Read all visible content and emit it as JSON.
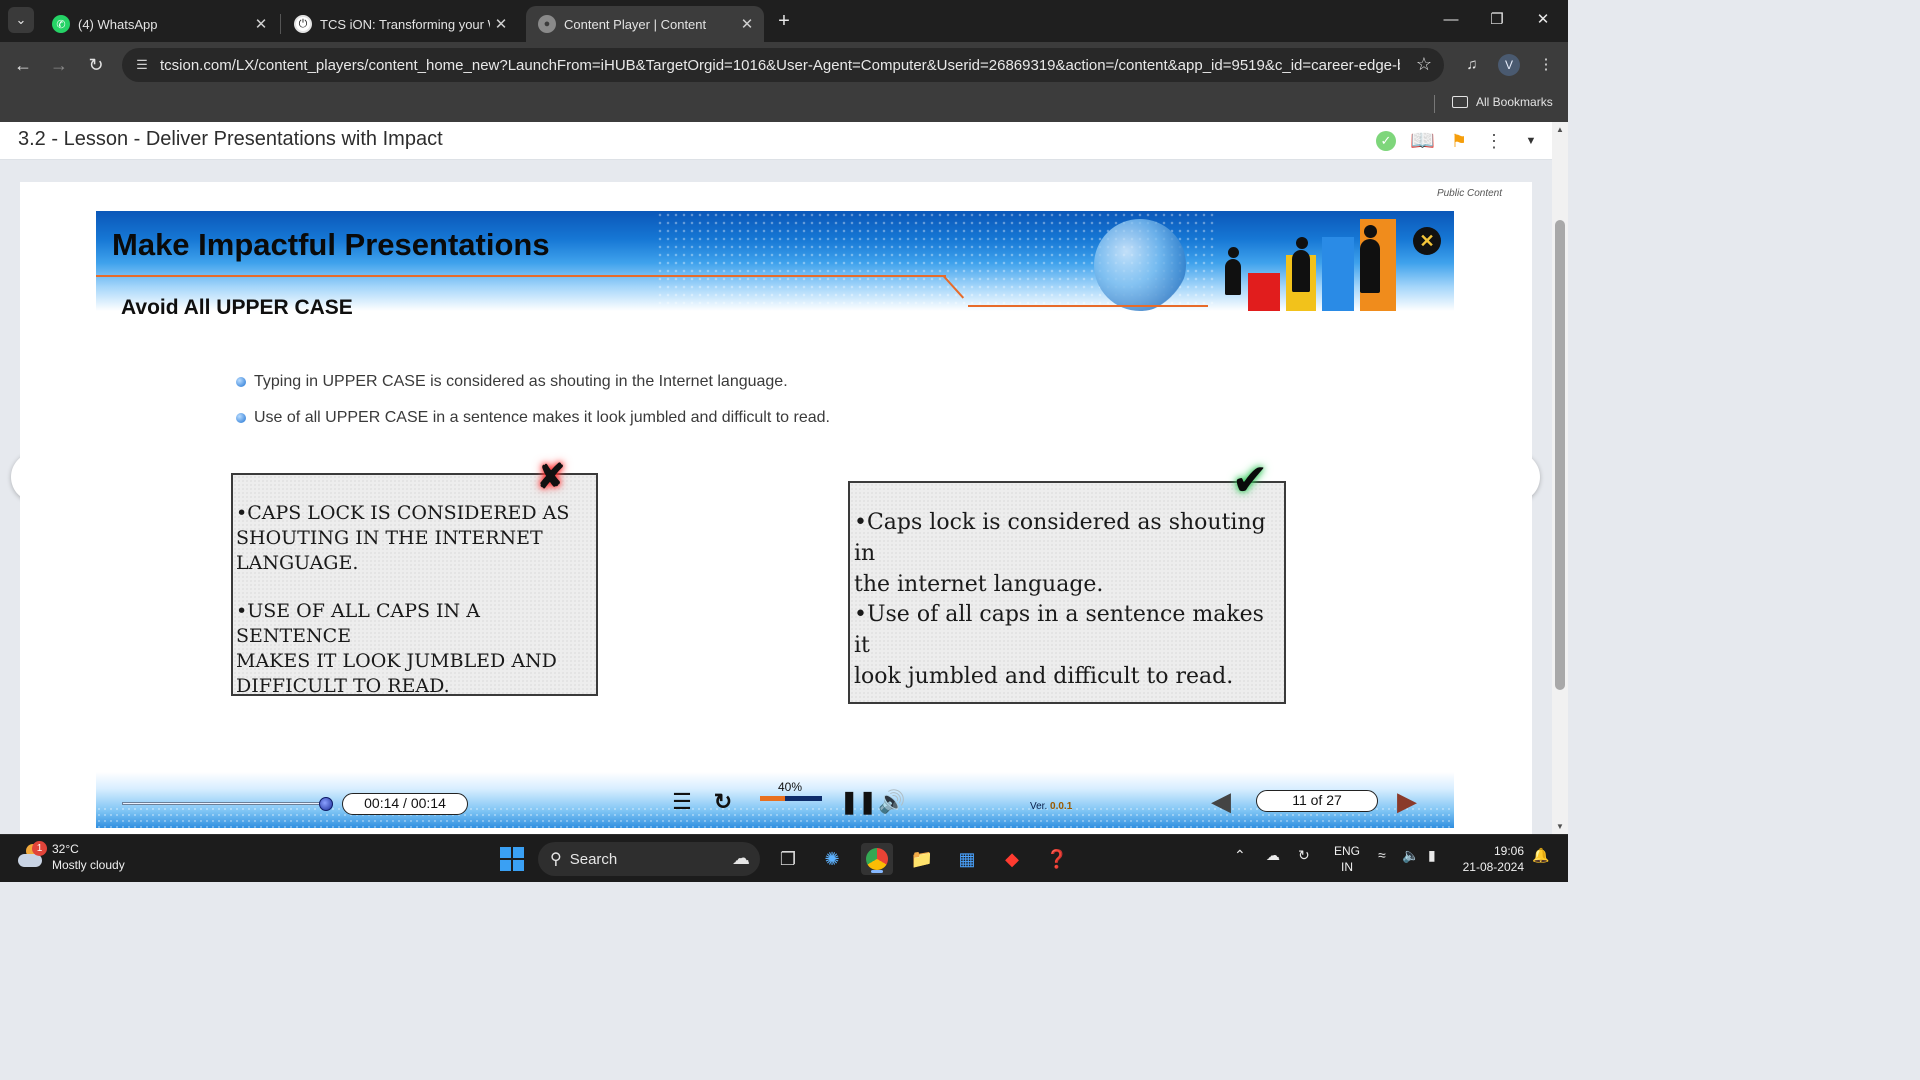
{
  "tabs": [
    {
      "title": "(4) WhatsApp",
      "icon": "whatsapp-icon"
    },
    {
      "title": "TCS iON: Transforming your Wo",
      "icon": "tcs-ion-icon"
    },
    {
      "title": "Content Player | Content",
      "icon": "globe-icon",
      "active": true
    }
  ],
  "address_bar": {
    "url": "tcsion.com/LX/content_players/content_home_new?LaunchFrom=iHUB&TargetOrgid=1016&User-Agent=Computer&Userid=26869319&action=/content&app_id=9519&c_id=career-edge-batch..."
  },
  "profile": {
    "initial": "V"
  },
  "bookmarks": {
    "all_label": "All Bookmarks"
  },
  "lesson": {
    "title": "3.2 - Lesson - Deliver Presentations with Impact"
  },
  "content": {
    "public_label": "Public Content",
    "banner_title": "Make Impactful Presentations",
    "subheading": "Avoid All UPPER CASE",
    "bullets": [
      "Typing in UPPER CASE is considered as shouting in the Internet language.",
      "Use of all UPPER CASE in a sentence makes it look jumbled and difficult to read."
    ],
    "bad_example": {
      "line1": "•CAPS LOCK IS CONSIDERED AS\n SHOUTING IN THE INTERNET\nLANGUAGE.",
      "line2": "•USE OF ALL CAPS IN A SENTENCE\nMAKES IT LOOK JUMBLED AND\nDIFFICULT TO READ."
    },
    "good_example": {
      "line1": "•Caps lock is considered as shouting in\nthe internet language.",
      "line2": "•Use of all caps in a sentence makes it\nlook jumbled and difficult to read."
    }
  },
  "player": {
    "time": "00:14 / 00:14",
    "seek_progress": 1.0,
    "volume_label": "40%",
    "volume_level": 0.4,
    "version_label": "Ver.",
    "version": "0.0.1",
    "page": "11 of 27"
  },
  "taskbar": {
    "temperature": "32°C",
    "weather": "Mostly cloudy",
    "weather_badge": "1",
    "search_label": "Search",
    "lang_top": "ENG",
    "lang_bottom": "IN",
    "time": "19:06",
    "date": "21-08-2024"
  },
  "colors": {
    "banner_blue": "#1677d4",
    "accent_orange": "#e76b2a",
    "check_green": "#7ed67b",
    "bookmark_orange": "#f59e0b"
  }
}
